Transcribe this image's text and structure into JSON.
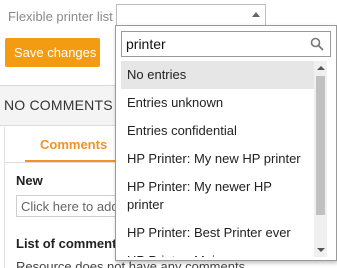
{
  "filter": {
    "label": "Flexible printer list",
    "search_value": "printer"
  },
  "actions": {
    "save_label": "Save changes"
  },
  "comments_section": {
    "header": "NO COMMENTS AVAILABLE",
    "tab_label": "Comments",
    "new_label": "New",
    "new_placeholder": "Click here to add a comment",
    "list_label": "List of comments",
    "empty_text": "Resource does not have any comments"
  },
  "dropdown_options": [
    "No entries",
    "Entries unknown",
    "Entries confidential",
    "HP Printer: My new HP printer",
    "HP Printer: My newer HP printer",
    "HP Printer: Best Printer ever",
    "HP Printer: Moin"
  ],
  "colors": {
    "accent": "#f39c12",
    "tab_active": "#f0932b",
    "highlight": "#e6e6e6"
  }
}
